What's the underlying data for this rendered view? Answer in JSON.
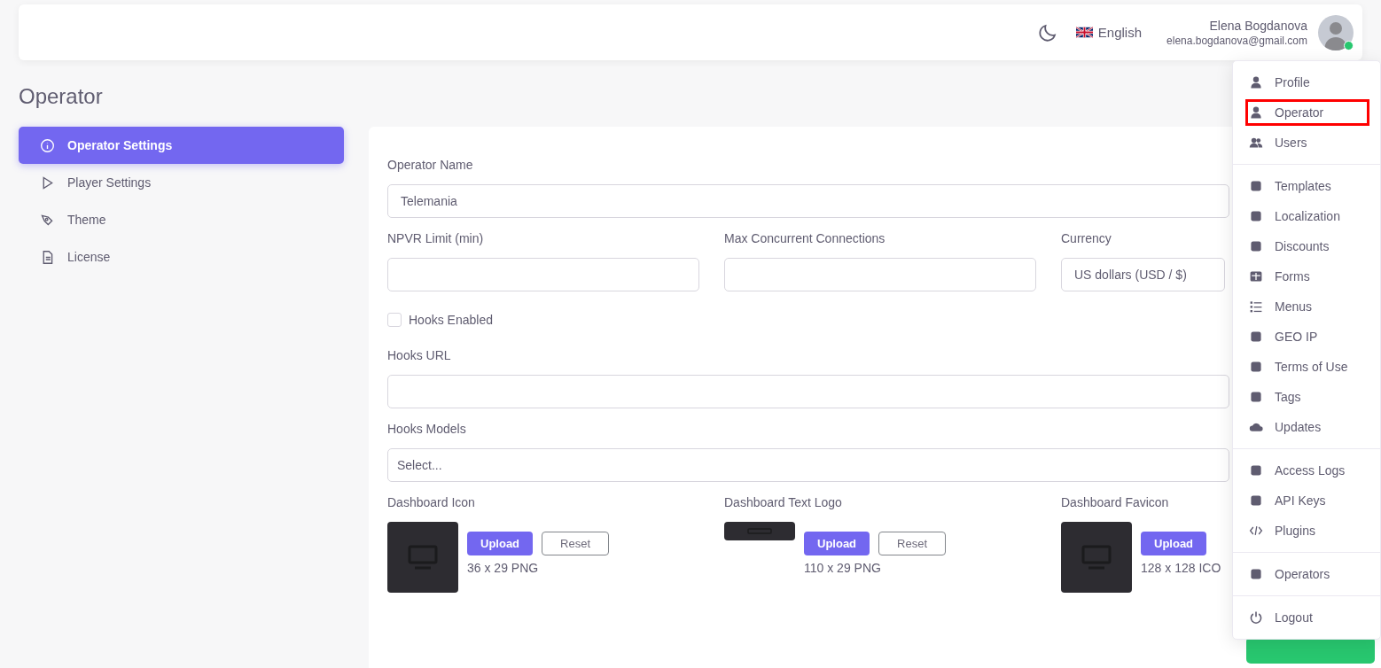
{
  "header": {
    "language": "English",
    "user": {
      "name": "Elena Bogdanova",
      "email": "elena.bogdanova@gmail.com",
      "online": true
    }
  },
  "page_title": "Operator",
  "sidebar": {
    "items": [
      {
        "label": "Operator Settings",
        "selected": true
      },
      {
        "label": "Player Settings",
        "selected": false
      },
      {
        "label": "Theme",
        "selected": false
      },
      {
        "label": "License",
        "selected": false
      }
    ]
  },
  "form": {
    "operator_name": {
      "label": "Operator Name",
      "value": "Telemania"
    },
    "npvr_limit": {
      "label": "NPVR Limit (min)"
    },
    "max_connections": {
      "label": "Max Concurrent Connections"
    },
    "currency": {
      "label": "Currency",
      "value": "US dollars (USD / $)"
    },
    "hooks_enabled": {
      "label": "Hooks Enabled",
      "checked": false
    },
    "hooks_url": {
      "label": "Hooks URL"
    },
    "hooks_models": {
      "label": "Hooks Models",
      "placeholder": "Select..."
    },
    "uploads": [
      {
        "label": "Dashboard Icon",
        "kind": "square",
        "upload": "Upload",
        "reset": "Reset",
        "size": "36 x 29 PNG"
      },
      {
        "label": "Dashboard Text Logo",
        "kind": "wide",
        "upload": "Upload",
        "reset": "Reset",
        "size": "110 x 29 PNG"
      },
      {
        "label": "Dashboard Favicon",
        "kind": "large",
        "upload": "Upload",
        "size": "128 x 128 ICO"
      }
    ]
  },
  "user_menu": {
    "groups": [
      [
        {
          "label": "Profile",
          "selected": false
        },
        {
          "label": "Operator",
          "selected": true
        },
        {
          "label": "Users",
          "selected": false
        }
      ],
      [
        {
          "label": "Templates",
          "selected": false
        },
        {
          "label": "Localization",
          "selected": false
        },
        {
          "label": "Discounts",
          "selected": false
        },
        {
          "label": "Forms",
          "selected": false
        },
        {
          "label": "Menus",
          "selected": false
        },
        {
          "label": "GEO IP",
          "selected": false
        },
        {
          "label": "Terms of Use",
          "selected": false
        },
        {
          "label": "Tags",
          "selected": false
        },
        {
          "label": "Updates",
          "selected": false
        }
      ],
      [
        {
          "label": "Access Logs",
          "selected": false
        },
        {
          "label": "API Keys",
          "selected": false
        },
        {
          "label": "Plugins",
          "selected": false
        }
      ],
      [
        {
          "label": "Operators",
          "selected": false
        }
      ],
      [
        {
          "label": "Logout",
          "selected": false
        }
      ]
    ]
  }
}
